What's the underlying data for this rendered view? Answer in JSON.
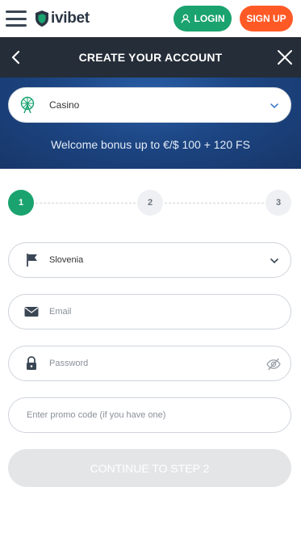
{
  "topbar": {
    "logo_text": "ivibet",
    "login_label": "LOGIN",
    "signup_label": "SIGN UP",
    "colors": {
      "login": "#1aa36f",
      "signup": "#ff5a26"
    }
  },
  "header": {
    "title": "CREATE YOUR ACCOUNT"
  },
  "banner": {
    "selected_product": "Casino",
    "bonus_text": "Welcome bonus up to €/$ 100 + 120 FS"
  },
  "steps": {
    "items": [
      "1",
      "2",
      "3"
    ],
    "active": 1
  },
  "form": {
    "country_value": "Slovenia",
    "email_placeholder": "Email",
    "password_placeholder": "Password",
    "promo_placeholder": "Enter promo code (if you have one)",
    "continue_label": "CONTINUE TO STEP 2"
  },
  "icons": [
    "menu-icon",
    "shield-logo-icon",
    "user-icon",
    "back-arrow-icon",
    "close-icon",
    "ferris-wheel-icon",
    "chevron-down-icon",
    "flag-icon",
    "envelope-icon",
    "lock-icon",
    "eye-hidden-icon"
  ]
}
